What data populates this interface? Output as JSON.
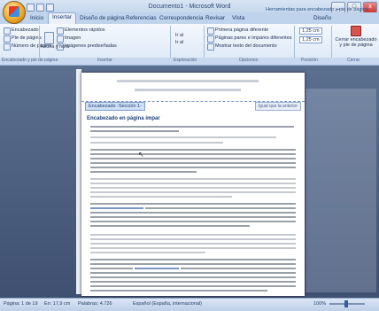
{
  "window": {
    "title": "Documento1 - Microsoft Word",
    "controls": {
      "minimize": "_",
      "maximize": "□",
      "close": "x"
    }
  },
  "tabs": [
    "Inicio",
    "Insertar",
    "Diseño de página",
    "Referencias",
    "Correspondencia",
    "Revisar",
    "Vista"
  ],
  "active_tab": "Insertar",
  "context_tab": {
    "group_title": "Herramientas para encabezado y pie de página",
    "tab": "Diseño"
  },
  "ribbon": {
    "col1": [
      "Encabezado",
      "Pie de página",
      "Número de página"
    ],
    "col2": [
      "Elementos rápidos",
      "Imagen",
      "Imágenes prediseñadas"
    ],
    "col3": [
      "Fecha y hora"
    ],
    "col4": [
      "Ir al",
      "Ir al"
    ],
    "col5": [
      "Primera página diferente",
      "Páginas pares e impares diferentes",
      "Mostrar texto del documento"
    ],
    "col6": [
      "1,25 cm",
      "1,25 cm"
    ],
    "close": "Cerrar encabezado y pie de página",
    "groups": [
      "Encabezado y pie de página",
      "Insertar",
      "Exploración",
      "Opciones",
      "Posición",
      "Cerrar"
    ]
  },
  "document": {
    "section_label": "Encabezado -Sección 1-",
    "header_label": "Igual que la anterior",
    "body_title": "Encabezado en página impar"
  },
  "statusbar": {
    "page": "Página: 1 de 19",
    "words": "En: 17,9 cm",
    "count": "Palabras: 4.726",
    "language": "Español (España, internacional)",
    "zoom": "100%"
  },
  "colors": {
    "ribbon": "#dbe7f6",
    "doc_bg": "#4c5f80",
    "accent": "#3b5c92"
  }
}
